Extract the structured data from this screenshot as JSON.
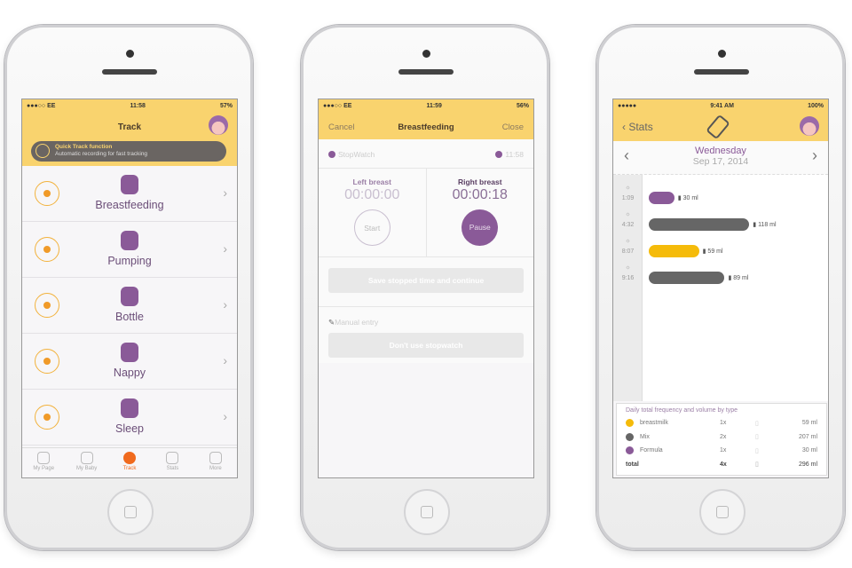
{
  "colors": {
    "yellow": "#f9d36e",
    "purple": "#8a5a98",
    "orange": "#f06a1e",
    "gray": "#666666",
    "gold": "#f5bb0a"
  },
  "track": {
    "status": {
      "carrier": "●●●○○ EE",
      "time": "11:58",
      "battery": "57%"
    },
    "title": "Track",
    "banner": {
      "title": "Quick Track function",
      "subtitle": "Automatic recording for fast tracking"
    },
    "items": [
      {
        "label": "Breastfeeding",
        "icon": "breastfeeding-icon"
      },
      {
        "label": "Pumping",
        "icon": "pump-icon"
      },
      {
        "label": "Bottle",
        "icon": "bottle-icon"
      },
      {
        "label": "Nappy",
        "icon": "nappy-icon"
      },
      {
        "label": "Sleep",
        "icon": "moon-icon"
      }
    ],
    "tabs": [
      {
        "label": "My Page"
      },
      {
        "label": "My Baby"
      },
      {
        "label": "Track",
        "active": true
      },
      {
        "label": "Stats"
      },
      {
        "label": "More"
      }
    ]
  },
  "feeding": {
    "status": {
      "carrier": "●●●○○ EE",
      "time": "11:59",
      "battery": "56%"
    },
    "cancel": "Cancel",
    "title": "Breastfeeding",
    "close": "Close",
    "stopwatch": "StopWatch",
    "clock": "11:58",
    "left": {
      "label": "Left breast",
      "time": "00:00:00",
      "button": "Start"
    },
    "right": {
      "label": "Right breast",
      "time": "00:00:18",
      "button": "Pause"
    },
    "save": "Save stopped time and continue",
    "manual": "Manual entry",
    "dont": "Don't use stopwatch"
  },
  "stats": {
    "status": {
      "carrier": "●●●●● ",
      "time": "9:41 AM",
      "battery": "100%"
    },
    "back": "Stats",
    "day": "Wednesday",
    "date": "Sep 17, 2014",
    "feeds": [
      {
        "time": "1:09",
        "ml": 30,
        "label": "30 ml",
        "type": "Formula"
      },
      {
        "time": "4:32",
        "ml": 118,
        "label": "118 ml",
        "type": "Mix"
      },
      {
        "time": "8:07",
        "ml": 59,
        "label": "59 ml",
        "type": "breastmilk"
      },
      {
        "time": "9:16",
        "ml": 89,
        "label": "89 ml",
        "type": "Mix"
      }
    ],
    "summary_title": "Daily total frequency and volume by type",
    "summary": [
      {
        "name": "breastmilk",
        "freq": "1x",
        "vol": "59 ml",
        "color": "#f5bb0a"
      },
      {
        "name": "Mix",
        "freq": "2x",
        "vol": "207 ml",
        "color": "#666666"
      },
      {
        "name": "Formula",
        "freq": "1x",
        "vol": "30 ml",
        "color": "#8a5a98"
      },
      {
        "name": "total",
        "freq": "4x",
        "vol": "296 ml"
      }
    ]
  }
}
